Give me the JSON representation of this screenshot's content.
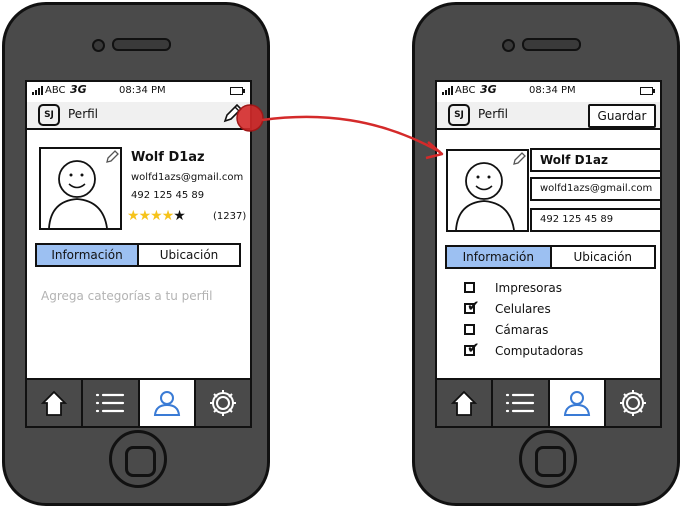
{
  "status_bar": {
    "carrier": "ABC",
    "network": "3G",
    "time": "08:34 PM"
  },
  "left_phone": {
    "nav": {
      "logo": "SJ",
      "title": "Perfil"
    },
    "profile": {
      "name": "Wolf D1az",
      "email": "wolfd1azs@gmail.com",
      "phone": "492 125 45 89",
      "rating": {
        "filled": 4,
        "total": 5,
        "count": "(1237)"
      }
    },
    "tabs": [
      {
        "label": "Información",
        "active": true
      },
      {
        "label": "Ubicación",
        "active": false
      }
    ],
    "placeholder": "Agrega categorías a tu perfil"
  },
  "right_phone": {
    "nav": {
      "logo": "SJ",
      "title": "Perfil",
      "save_label": "Guardar"
    },
    "fields": {
      "name": "Wolf D1az",
      "email": "wolfd1azs@gmail.com",
      "phone": "492 125 45 89"
    },
    "tabs": [
      {
        "label": "Información",
        "active": true
      },
      {
        "label": "Ubicación",
        "active": false
      }
    ],
    "categories": [
      {
        "label": "Impresoras",
        "checked": false
      },
      {
        "label": "Celulares",
        "checked": true
      },
      {
        "label": "Cámaras",
        "checked": false
      },
      {
        "label": "Computadoras",
        "checked": true
      }
    ]
  },
  "tabbar": [
    {
      "icon": "home-icon"
    },
    {
      "icon": "list-icon"
    },
    {
      "icon": "user-icon",
      "active": true
    },
    {
      "icon": "gear-icon"
    }
  ],
  "colors": {
    "star": "#f6c31a",
    "tab_active": "#9cc0f2",
    "user_icon": "#3a7bd5",
    "link_arrow": "#d42a2a"
  }
}
